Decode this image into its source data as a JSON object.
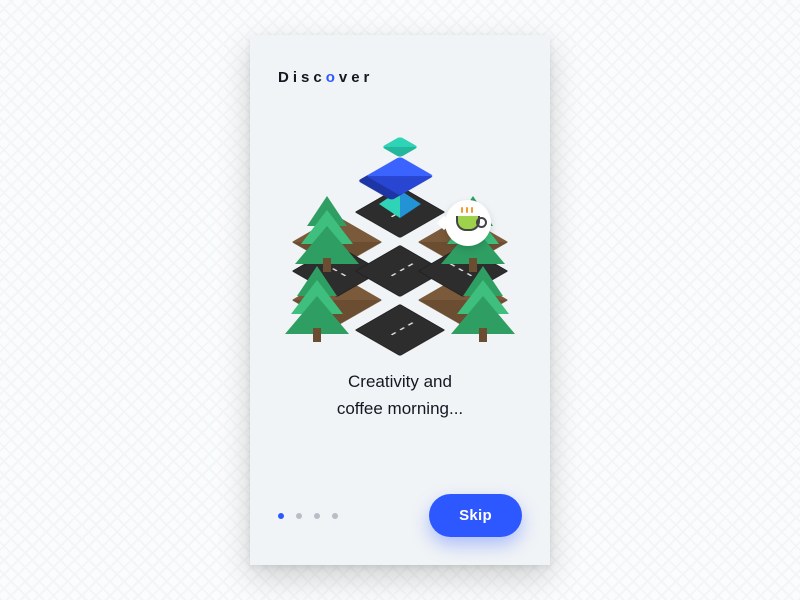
{
  "brand": {
    "pre": "Disc",
    "accent": "o",
    "post": "ver"
  },
  "illustration": {
    "coffee_icon": "coffee-cup-icon"
  },
  "caption": {
    "line1": "Creativity and",
    "line2": "coffee morning..."
  },
  "pager": {
    "count": 4,
    "active_index": 0
  },
  "actions": {
    "skip_label": "Skip"
  },
  "colors": {
    "accent": "#2e58ff",
    "bg": "#f1f4f6"
  }
}
